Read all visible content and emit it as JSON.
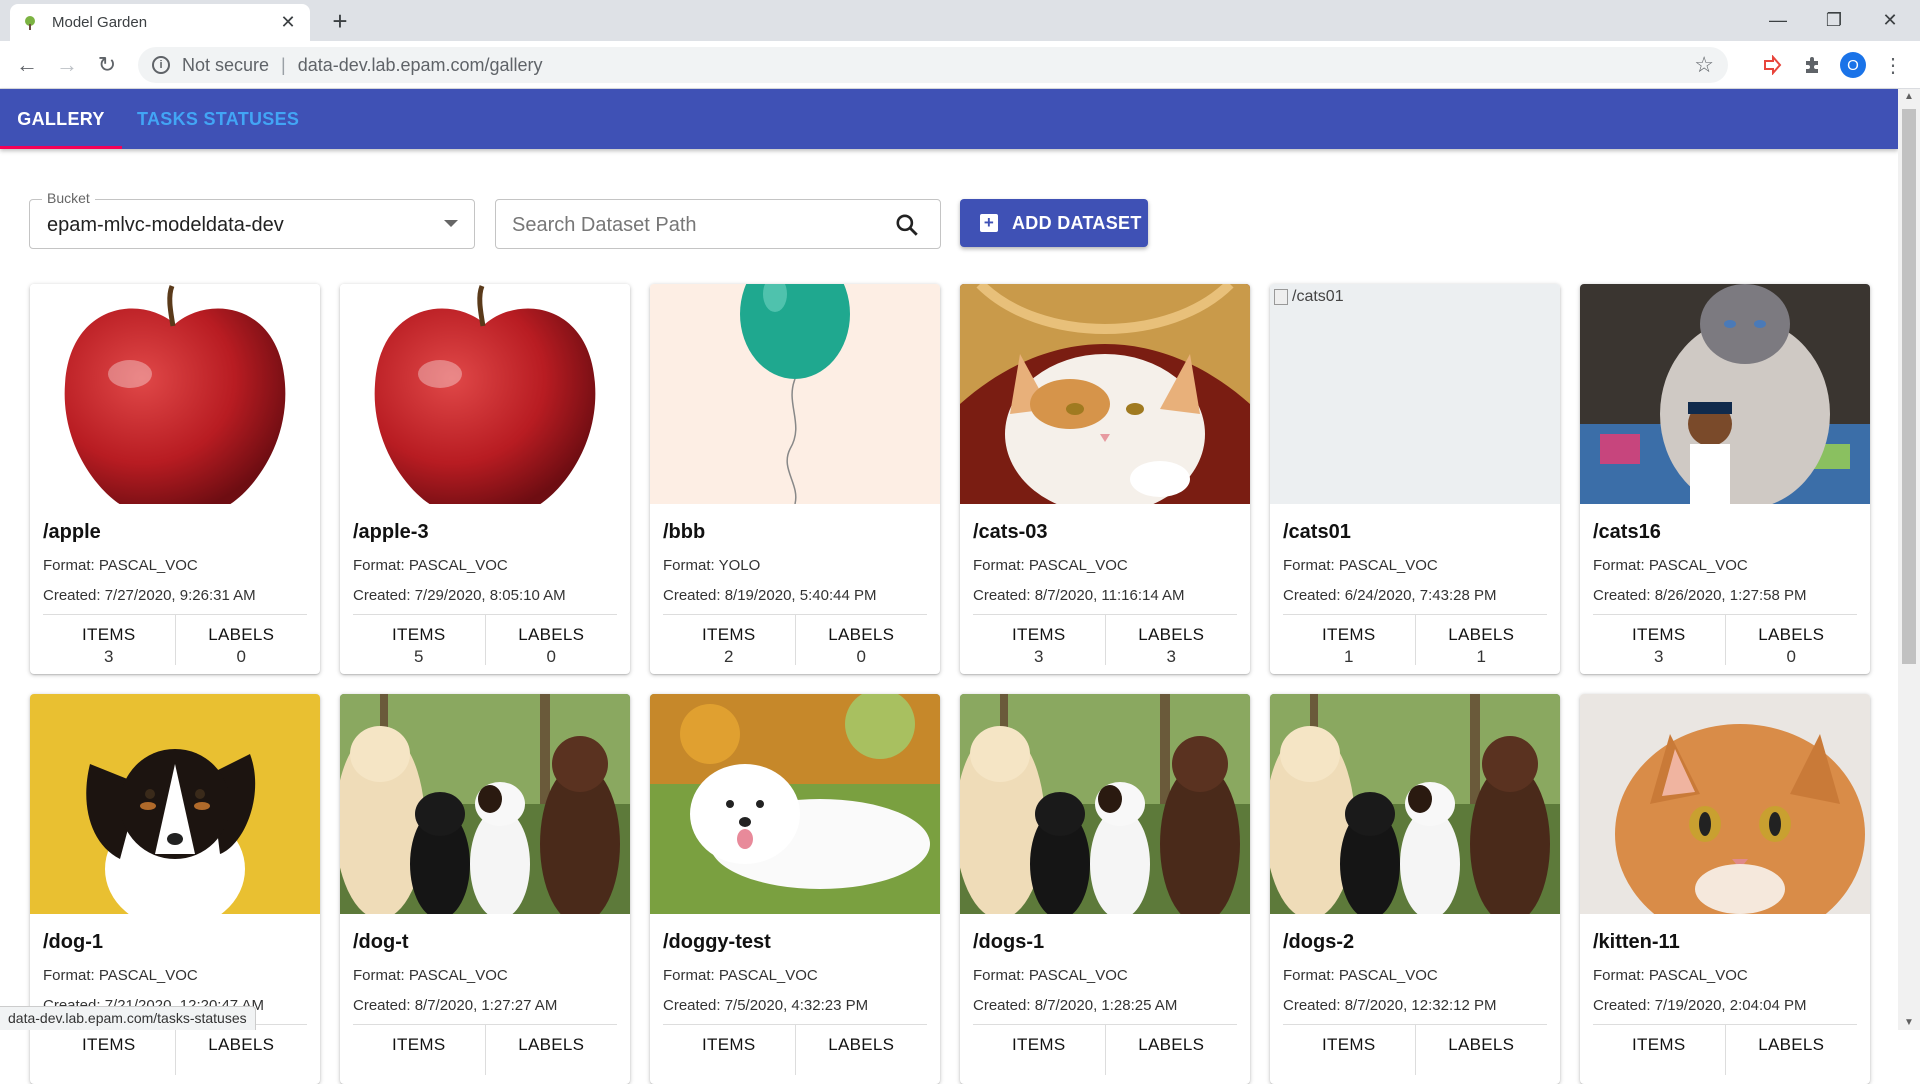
{
  "browser": {
    "tab_title": "Model Garden",
    "security_label": "Not secure",
    "url": "data-dev.lab.epam.com/gallery",
    "profile_initial": "O",
    "status_url": "data-dev.lab.epam.com/tasks-statuses"
  },
  "appbar": {
    "tabs": [
      {
        "label": "GALLERY"
      },
      {
        "label": "TASKS STATUSES"
      }
    ],
    "accent_color": "#3f51b5",
    "active_indicator_color": "#f50057",
    "inactive_tab_color": "#42a5f5"
  },
  "controls": {
    "bucket_label": "Bucket",
    "bucket_value": "epam-mlvc-modeldata-dev",
    "search_placeholder": "Search Dataset Path",
    "add_button_label": "ADD DATASET"
  },
  "stat_labels": {
    "items": "ITEMS",
    "labels": "LABELS"
  },
  "datasets": [
    {
      "name": "/apple",
      "format": "Format: PASCAL_VOC",
      "created": "Created: 7/27/2020, 9:26:31 AM",
      "items": "3",
      "labels": "0",
      "image": "apple"
    },
    {
      "name": "/apple-3",
      "format": "Format: PASCAL_VOC",
      "created": "Created: 7/29/2020, 8:05:10 AM",
      "items": "5",
      "labels": "0",
      "image": "apple"
    },
    {
      "name": "/bbb",
      "format": "Format: YOLO",
      "created": "Created: 8/19/2020, 5:40:44 PM",
      "items": "2",
      "labels": "0",
      "image": "balloon"
    },
    {
      "name": "/cats-03",
      "format": "Format: PASCAL_VOC",
      "created": "Created: 8/7/2020, 11:16:14 AM",
      "items": "3",
      "labels": "3",
      "image": "cat-basket"
    },
    {
      "name": "/cats01",
      "format": "Format: PASCAL_VOC",
      "created": "Created: 6/24/2020, 7:43:28 PM",
      "items": "1",
      "labels": "1",
      "image": "broken",
      "alt": "/cats01"
    },
    {
      "name": "/cats16",
      "format": "Format: PASCAL_VOC",
      "created": "Created: 8/26/2020, 1:27:58 PM",
      "items": "3",
      "labels": "0",
      "image": "siamese"
    },
    {
      "name": "/dog-1",
      "format": "Format: PASCAL_VOC",
      "created": "Created: 7/21/2020, 12:20:47 AM",
      "items": "",
      "labels": "",
      "image": "dog-yellow"
    },
    {
      "name": "/dog-t",
      "format": "Format: PASCAL_VOC",
      "created": "Created: 8/7/2020, 1:27:27 AM",
      "items": "",
      "labels": "",
      "image": "dogs-group"
    },
    {
      "name": "/doggy-test",
      "format": "Format: PASCAL_VOC",
      "created": "Created: 7/5/2020, 4:32:23 PM",
      "items": "",
      "labels": "",
      "image": "samoyed"
    },
    {
      "name": "/dogs-1",
      "format": "Format: PASCAL_VOC",
      "created": "Created: 8/7/2020, 1:28:25 AM",
      "items": "",
      "labels": "",
      "image": "dogs-group"
    },
    {
      "name": "/dogs-2",
      "format": "Format: PASCAL_VOC",
      "created": "Created: 8/7/2020, 12:32:12 PM",
      "items": "",
      "labels": "",
      "image": "dogs-group"
    },
    {
      "name": "/kitten-11",
      "format": "Format: PASCAL_VOC",
      "created": "Created: 7/19/2020, 2:04:04 PM",
      "items": "",
      "labels": "",
      "image": "kitten"
    }
  ]
}
